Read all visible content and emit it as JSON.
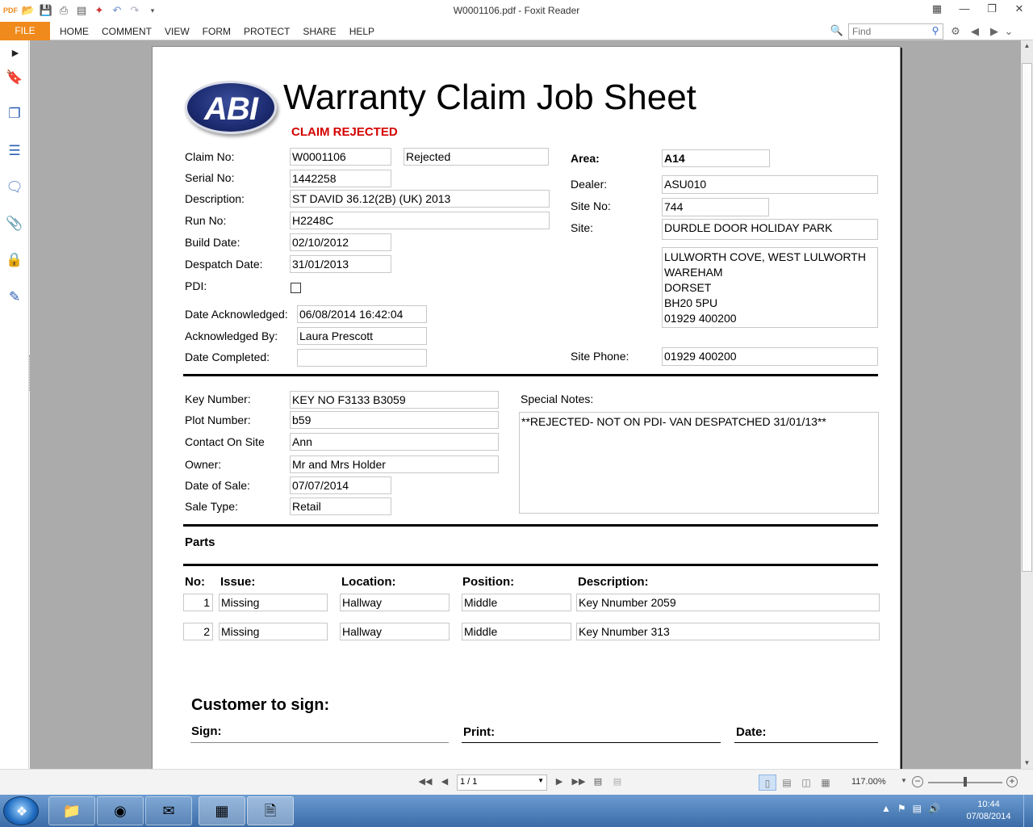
{
  "app": {
    "window_title": "W0001106.pdf - Foxit Reader",
    "file_tab": "FILE",
    "menu_tabs": [
      "HOME",
      "COMMENT",
      "VIEW",
      "FORM",
      "PROTECT",
      "SHARE",
      "HELP"
    ],
    "find_placeholder": "Find"
  },
  "document": {
    "logo_text": "ABI",
    "title": "Warranty Claim Job Sheet",
    "status": "CLAIM REJECTED",
    "left_labels": {
      "claim_no": "Claim No:",
      "serial_no": "Serial No:",
      "description": "Description:",
      "run_no": "Run No:",
      "build_date": "Build Date:",
      "despatch_date": "Despatch Date:",
      "pdi": "PDI:",
      "date_acknowledged": "Date Acknowledged:",
      "acknowledged_by": "Acknowledged By:",
      "date_completed": "Date Completed:"
    },
    "left_values": {
      "claim_no": "W0001106",
      "claim_status": "Rejected",
      "serial_no": "1442258",
      "description": "ST DAVID 36.12(2B) (UK) 2013",
      "run_no": "H2248C",
      "build_date": "02/10/2012",
      "despatch_date": "31/01/2013",
      "pdi_checked": false,
      "date_acknowledged": "06/08/2014 16:42:04",
      "acknowledged_by": "Laura Prescott",
      "date_completed": ""
    },
    "right_labels": {
      "area": "Area:",
      "dealer": "Dealer:",
      "site_no": "Site No:",
      "site": "Site:",
      "site_phone": "Site Phone:"
    },
    "right_values": {
      "area": "A14",
      "dealer": "ASU010",
      "site_no": "744",
      "site": "DURDLE DOOR HOLIDAY PARK",
      "address": [
        "LULWORTH COVE, WEST LULWORTH",
        "WAREHAM",
        "DORSET",
        "BH20 5PU",
        "01929 400200"
      ],
      "site_phone": "01929 400200"
    },
    "mid_labels": {
      "key_number": "Key Number:",
      "plot_number": "Plot Number:",
      "contact_on_site": "Contact On Site",
      "owner": "Owner:",
      "date_of_sale": "Date of Sale:",
      "sale_type": "Sale Type:",
      "special_notes": "Special Notes:"
    },
    "mid_values": {
      "key_number": "KEY NO F3133 B3059",
      "plot_number": "b59",
      "contact_on_site": "Ann",
      "owner": "Mr and Mrs Holder",
      "date_of_sale": "07/07/2014",
      "sale_type": "Retail",
      "special_notes": "**REJECTED- NOT ON PDI- VAN DESPATCHED 31/01/13**"
    },
    "parts": {
      "heading": "Parts",
      "columns": [
        "No:",
        "Issue:",
        "Location:",
        "Position:",
        "Description:"
      ],
      "rows": [
        {
          "no": "1",
          "issue": "Missing",
          "location": "Hallway",
          "position": "Middle",
          "description": "Key Nnumber 2059"
        },
        {
          "no": "2",
          "issue": "Missing",
          "location": "Hallway",
          "position": "Middle",
          "description": "Key Nnumber 313"
        }
      ]
    },
    "signoff": {
      "heading": "Customer to sign:",
      "sign": "Sign:",
      "print": "Print:",
      "date": "Date:"
    }
  },
  "statusbar": {
    "page_indicator": "1 / 1",
    "zoom": "117.00%"
  },
  "taskbar": {
    "time": "10:44",
    "date": "07/08/2014"
  },
  "colors": {
    "file_tab": "#f08a1c",
    "status_red": "#d40000",
    "logo_blue": "#1d2c72",
    "doc_background": "#ababab"
  },
  "icons": {
    "sidebar": [
      "bookmark-icon",
      "pages-icon",
      "layers-icon",
      "comments-icon",
      "attachments-icon",
      "security-icon",
      "signature-icon"
    ],
    "taskbar": [
      "explorer-icon",
      "chrome-icon",
      "outlook-icon",
      "calculator-icon",
      "foxit-icon"
    ]
  }
}
